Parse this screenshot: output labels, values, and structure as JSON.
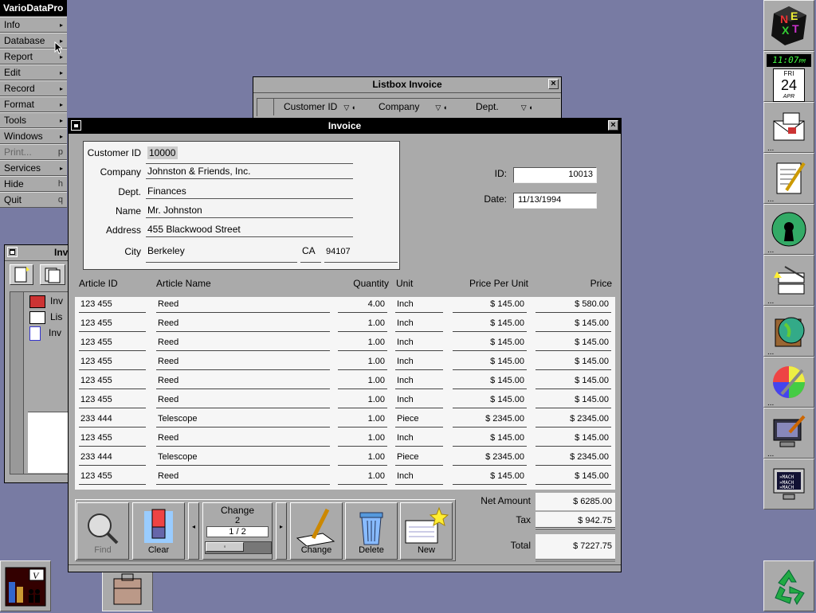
{
  "menu": {
    "title": "VarioDataPro",
    "items": [
      {
        "label": "Info",
        "key": "▸"
      },
      {
        "label": "Database",
        "key": "▸"
      },
      {
        "label": "Report",
        "key": "▸"
      },
      {
        "label": "Edit",
        "key": "▸"
      },
      {
        "label": "Record",
        "key": "▸"
      },
      {
        "label": "Format",
        "key": "▸"
      },
      {
        "label": "Tools",
        "key": "▸"
      },
      {
        "label": "Windows",
        "key": "▸"
      },
      {
        "label": "Print...",
        "key": "p"
      },
      {
        "label": "Services",
        "key": "▸"
      },
      {
        "label": "Hide",
        "key": "h"
      },
      {
        "label": "Quit",
        "key": "q"
      }
    ]
  },
  "dock": {
    "time": "11:07",
    "ampm": "PM",
    "day": "FRI",
    "date": "24",
    "month": "APR",
    "icons": [
      "next-logo-icon",
      "clock-icon",
      "mail-icon",
      "text-editor-icon",
      "keyhole-globe-icon",
      "preferences-icon",
      "globe-book-icon",
      "color-wheel-icon",
      "monitor-tool-icon",
      "mach-terminal-icon",
      "recycler-icon"
    ]
  },
  "browser": {
    "title": "Inv",
    "items": [
      "Inv",
      "Lis",
      "Inv"
    ]
  },
  "listbox": {
    "title": "Listbox Invoice",
    "cols": [
      "Customer ID",
      "Company",
      "Dept."
    ]
  },
  "invoice": {
    "title": "Invoice",
    "labels": {
      "customer_id": "Customer ID",
      "company": "Company",
      "dept": "Dept.",
      "name": "Name",
      "address": "Address",
      "city": "City",
      "id": "ID:",
      "date": "Date:"
    },
    "customer_id": "10000",
    "company": "Johnston & Friends, Inc.",
    "dept": "Finances",
    "name": "Mr. Johnston",
    "address": "455 Blackwood Street",
    "city": "Berkeley",
    "state": "CA",
    "zip": "94107",
    "id": "10013",
    "date": "11/13/1994",
    "table": {
      "headers": [
        "Article ID",
        "Article Name",
        "Quantity",
        "Unit",
        "Price Per Unit",
        "Price"
      ],
      "rows": [
        [
          "123 455",
          "Reed",
          "4.00",
          "Inch",
          "$ 145.00",
          "$ 580.00"
        ],
        [
          "123 455",
          "Reed",
          "1.00",
          "Inch",
          "$ 145.00",
          "$ 145.00"
        ],
        [
          "123 455",
          "Reed",
          "1.00",
          "Inch",
          "$ 145.00",
          "$ 145.00"
        ],
        [
          "123 455",
          "Reed",
          "1.00",
          "Inch",
          "$ 145.00",
          "$ 145.00"
        ],
        [
          "123 455",
          "Reed",
          "1.00",
          "Inch",
          "$ 145.00",
          "$ 145.00"
        ],
        [
          "123 455",
          "Reed",
          "1.00",
          "Inch",
          "$ 145.00",
          "$ 145.00"
        ],
        [
          "233 444",
          "Telescope",
          "1.00",
          "Piece",
          "$ 2345.00",
          "$ 2345.00"
        ],
        [
          "123 455",
          "Reed",
          "1.00",
          "Inch",
          "$ 145.00",
          "$ 145.00"
        ],
        [
          "233 444",
          "Telescope",
          "1.00",
          "Piece",
          "$ 2345.00",
          "$ 2345.00"
        ],
        [
          "123 455",
          "Reed",
          "1.00",
          "Inch",
          "$ 145.00",
          "$ 145.00"
        ]
      ]
    },
    "toolbar": {
      "find": "Find",
      "clear": "Clear",
      "change_label": "Change",
      "change_count": "2",
      "change_page": "1 / 2",
      "change": "Change",
      "delete": "Delete",
      "new": "New"
    },
    "totals": {
      "net_label": "Net Amount",
      "net": "$ 6285.00",
      "tax_label": "Tax",
      "tax": "$ 942.75",
      "total_label": "Total",
      "total": "$ 7227.75"
    }
  }
}
